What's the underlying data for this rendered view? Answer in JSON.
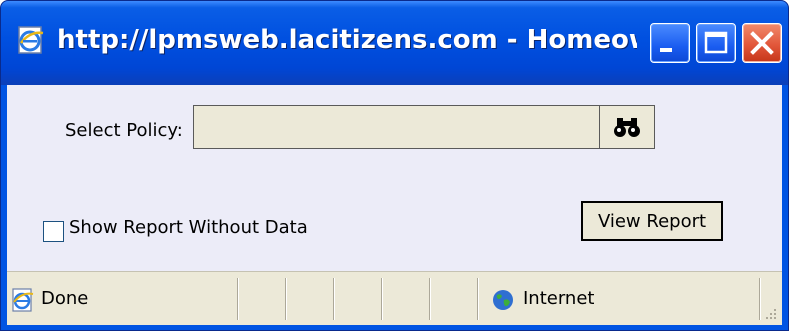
{
  "window": {
    "title": "http://lpmsweb.lacitizens.com - Homeowner ...",
    "icon": "ie-page-icon",
    "controls": {
      "minimize": "minimize-icon",
      "maximize": "maximize-icon",
      "close": "close-icon"
    },
    "colors": {
      "titlebar": "#0054e3",
      "close": "#e2573a",
      "client": "#ececf8",
      "chrome": "#ece9d8"
    }
  },
  "form": {
    "policy_label": "Select Policy:",
    "policy_value": "",
    "lookup_icon": "binoculars-icon",
    "checkbox_label": "Show Report Without Data",
    "checkbox_checked": false,
    "view_button_label": "View Report"
  },
  "status": {
    "text": "Done",
    "zone": "Internet",
    "status_icon": "ie-icon",
    "zone_icon": "globe-icon"
  }
}
